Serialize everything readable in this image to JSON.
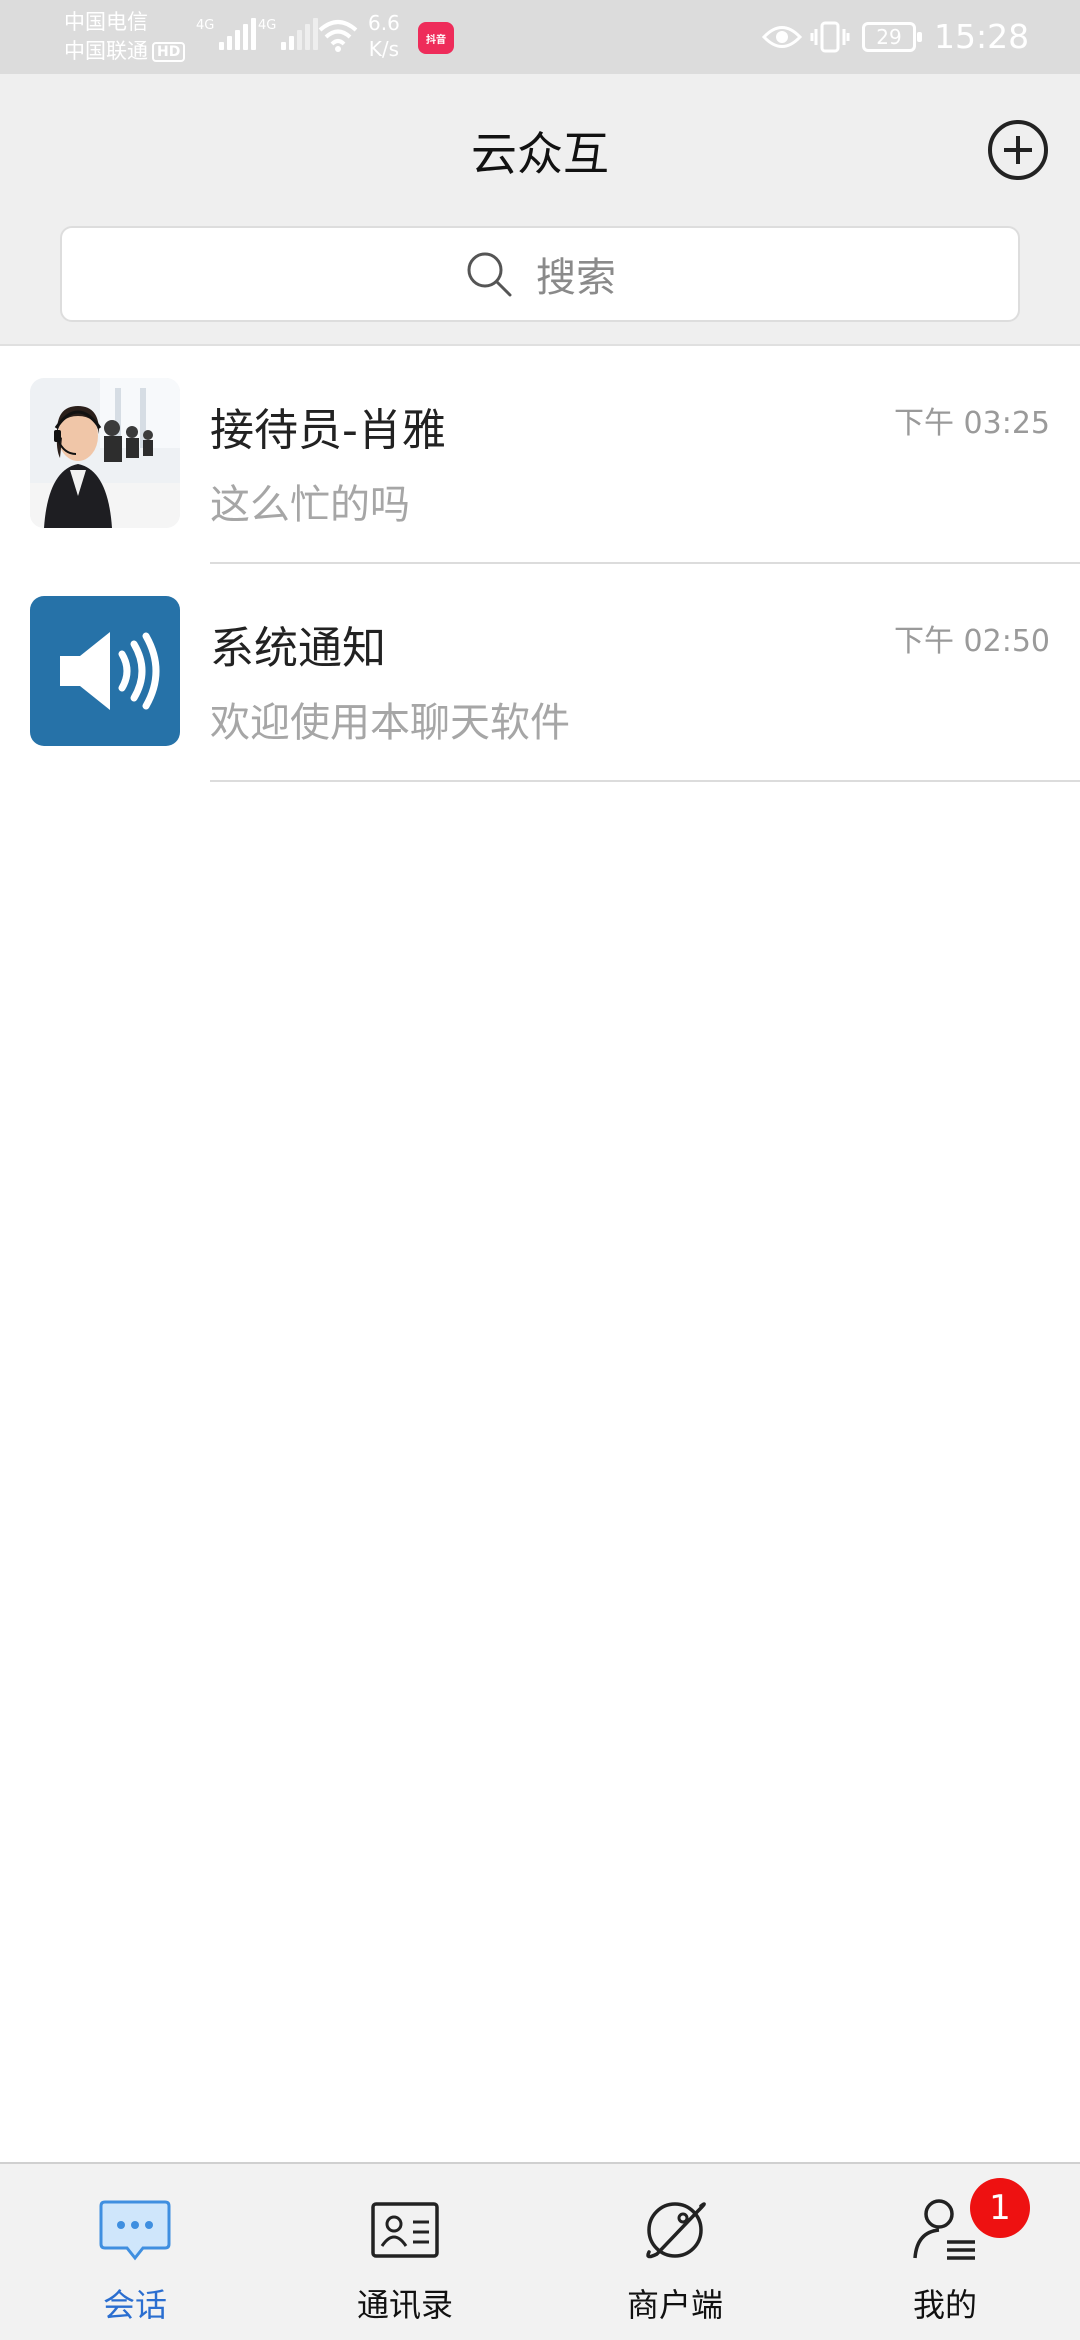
{
  "status_bar": {
    "carrier1": "中国电信",
    "carrier2": "中国联通",
    "hd_label": "HD",
    "network1": "4G",
    "network2": "4G",
    "speed_value": "6.6",
    "speed_unit": "K/s",
    "app_badge_text": "抖音",
    "battery": "29",
    "time": "15:28"
  },
  "header": {
    "title": "云众互",
    "add_icon": "plus-circle-icon"
  },
  "search": {
    "placeholder": "搜索",
    "icon": "search-icon"
  },
  "conversations": [
    {
      "name": "接待员-肖雅",
      "preview": "这么忙的吗",
      "time": "下午 03:25",
      "avatar": "agent-photo"
    },
    {
      "name": "系统通知",
      "preview": "欢迎使用本聊天软件",
      "time": "下午 02:50",
      "avatar": "speaker-icon",
      "avatar_color": "#2672a8"
    }
  ],
  "tab_bar": {
    "active_color": "#2a6ed0",
    "tabs": [
      {
        "label": "会话",
        "icon": "chat-bubble-icon",
        "active": true
      },
      {
        "label": "通讯录",
        "icon": "contact-card-icon",
        "active": false
      },
      {
        "label": "商户端",
        "icon": "planet-icon",
        "active": false
      },
      {
        "label": "我的",
        "icon": "user-list-icon",
        "active": false,
        "badge": "1"
      }
    ]
  }
}
